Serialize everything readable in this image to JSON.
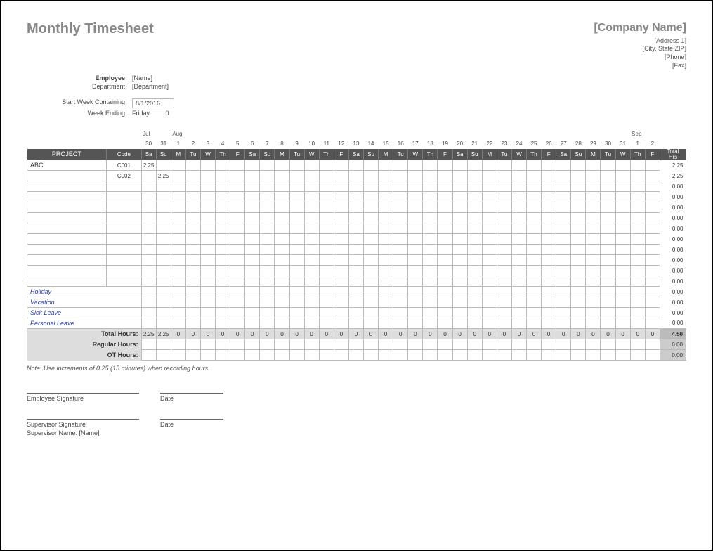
{
  "title": "Monthly Timesheet",
  "company": {
    "name": "[Company Name]",
    "address1": "[Address 1]",
    "address2": "[City, State ZIP]",
    "phone": "[Phone]",
    "fax": "[Fax]"
  },
  "meta": {
    "employee_label": "Employee",
    "employee_value": "[Name]",
    "department_label": "Department",
    "department_value": "[Department]",
    "start_week_label": "Start Week Containing",
    "start_week_value": "8/1/2016",
    "week_ending_label": "Week Ending",
    "week_ending_value": "Friday",
    "week_ending_extra": "0"
  },
  "calendar": {
    "months": [
      {
        "label": "Jul",
        "col": 0
      },
      {
        "label": "Aug",
        "col": 2
      },
      {
        "label": "Sep",
        "col": 33
      }
    ],
    "daynums": [
      "30",
      "31",
      "1",
      "2",
      "3",
      "4",
      "5",
      "6",
      "7",
      "8",
      "9",
      "10",
      "11",
      "12",
      "13",
      "14",
      "15",
      "16",
      "17",
      "18",
      "19",
      "20",
      "21",
      "22",
      "23",
      "24",
      "25",
      "26",
      "27",
      "28",
      "29",
      "30",
      "31",
      "1",
      "2"
    ],
    "daydows": [
      "Sa",
      "Su",
      "M",
      "Tu",
      "W",
      "Th",
      "F",
      "Sa",
      "Su",
      "M",
      "Tu",
      "W",
      "Th",
      "F",
      "Sa",
      "Su",
      "M",
      "Tu",
      "W",
      "Th",
      "F",
      "Sa",
      "Su",
      "M",
      "Tu",
      "W",
      "Th",
      "F",
      "Sa",
      "Su",
      "M",
      "Tu",
      "W",
      "Th",
      "F"
    ]
  },
  "headers": {
    "project": "PROJECT",
    "code": "Code",
    "total": "Total Hrs"
  },
  "rows": [
    {
      "project": "ABC",
      "code": "C001",
      "cells": {
        "0": "2.25"
      },
      "total": "2.25"
    },
    {
      "project": "",
      "code": "C002",
      "cells": {
        "1": "2.25"
      },
      "total": "2.25"
    },
    {
      "project": "",
      "code": "",
      "cells": {},
      "total": "0.00"
    },
    {
      "project": "",
      "code": "",
      "cells": {},
      "total": "0.00"
    },
    {
      "project": "",
      "code": "",
      "cells": {},
      "total": "0.00"
    },
    {
      "project": "",
      "code": "",
      "cells": {},
      "total": "0.00"
    },
    {
      "project": "",
      "code": "",
      "cells": {},
      "total": "0.00"
    },
    {
      "project": "",
      "code": "",
      "cells": {},
      "total": "0.00"
    },
    {
      "project": "",
      "code": "",
      "cells": {},
      "total": "0.00"
    },
    {
      "project": "",
      "code": "",
      "cells": {},
      "total": "0.00"
    },
    {
      "project": "",
      "code": "",
      "cells": {},
      "total": "0.00"
    },
    {
      "project": "",
      "code": "",
      "cells": {},
      "total": "0.00"
    }
  ],
  "leave_rows": [
    {
      "project": "Holiday",
      "total": "0.00"
    },
    {
      "project": "Vacation",
      "total": "0.00"
    },
    {
      "project": "Sick Leave",
      "total": "0.00"
    },
    {
      "project": "Personal Leave",
      "total": "0.00"
    }
  ],
  "totals": {
    "total_hours_label": "Total Hours:",
    "total_hours": [
      "2.25",
      "2.25",
      "0",
      "0",
      "0",
      "0",
      "0",
      "0",
      "0",
      "0",
      "0",
      "0",
      "0",
      "0",
      "0",
      "0",
      "0",
      "0",
      "0",
      "0",
      "0",
      "0",
      "0",
      "0",
      "0",
      "0",
      "0",
      "0",
      "0",
      "0",
      "0",
      "0",
      "0",
      "0",
      "0"
    ],
    "total_hours_grand": "4.50",
    "regular_label": "Regular Hours:",
    "regular_grand": "0.00",
    "ot_label": "OT Hours:",
    "ot_grand": "0.00"
  },
  "note": "Note: Use increments of 0.25 (15 minutes) when recording hours.",
  "signatures": {
    "employee_sig": "Employee Signature",
    "date": "Date",
    "supervisor_sig": "Supervisor Signature",
    "supervisor_name_label": "Supervisor Name:",
    "supervisor_name_value": "[Name]"
  }
}
